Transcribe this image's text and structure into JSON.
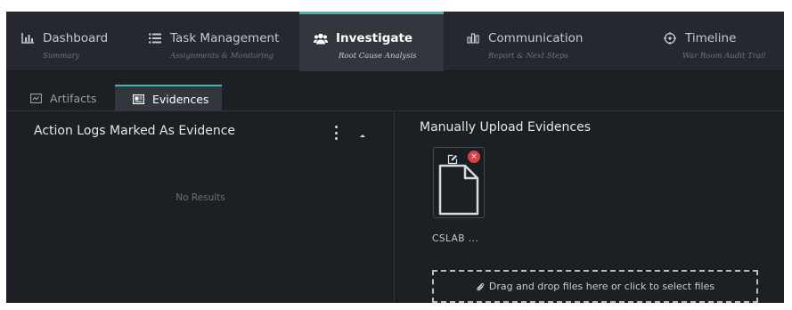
{
  "nav": {
    "tabs": [
      {
        "label": "Dashboard",
        "sub": "Summary",
        "icon": "bar-chart-icon"
      },
      {
        "label": "Task Management",
        "sub": "Assignments & Monitoring",
        "icon": "list-icon"
      },
      {
        "label": "Investigate",
        "sub": "Root Cause Analysis",
        "icon": "users-icon",
        "active": true
      },
      {
        "label": "Communication",
        "sub": "Report & Next Steps",
        "icon": "column-chart-icon"
      },
      {
        "label": "Timeline",
        "sub": "War Room Audit Trail",
        "icon": "target-icon"
      }
    ]
  },
  "subtabs": [
    {
      "label": "Artifacts",
      "icon": "artifact-icon"
    },
    {
      "label": "Evidences",
      "icon": "evidence-icon",
      "active": true
    }
  ],
  "left_panel": {
    "title": "Action Logs Marked As Evidence",
    "empty_text": "No Results"
  },
  "right_panel": {
    "title": "Manually Upload Evidences",
    "file": {
      "name": "CSLAB ...",
      "delete_glyph": "×"
    },
    "dropzone_text": "Drag and drop files here or click to select files"
  },
  "colors": {
    "accent": "#3fb7b0",
    "danger": "#d64040",
    "background": "#1c1f24",
    "nav_background": "#25282e"
  }
}
